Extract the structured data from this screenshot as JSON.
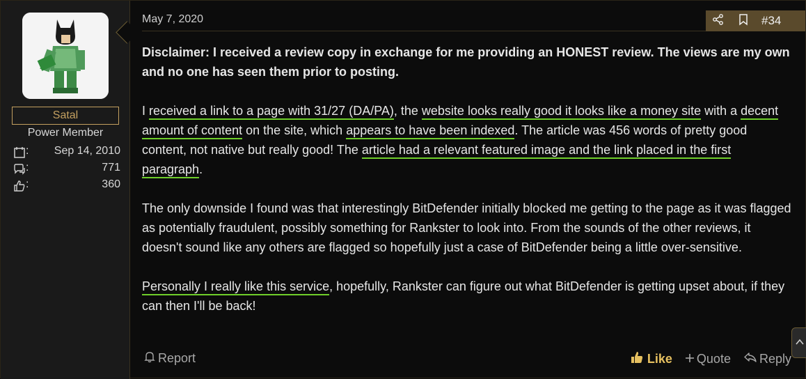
{
  "user": {
    "name": "Satal",
    "title": "Power Member",
    "stats": [
      {
        "icon": "calendar-icon",
        "value": "Sep 14, 2010"
      },
      {
        "icon": "messages-icon",
        "value": "771"
      },
      {
        "icon": "thumbs-up-icon",
        "value": "360"
      }
    ]
  },
  "post": {
    "date": "May 7, 2020",
    "number": "#34",
    "disclaimer": "Disclaimer: I received a review copy in exchange for me providing an HONEST review. The views are my own and no one has seen them prior to posting.",
    "p2": {
      "t1": "I ",
      "u1": "received a link to a page with 31/27 (DA/PA)",
      "t2": ", the ",
      "u2": "website looks really good it looks like a money site",
      "t3": " with a ",
      "u3": "decent amount of content",
      "t4": " on the site, which ",
      "u4": "appears to have been indexed",
      "t5": ". The article was 456 words of pretty good content, not native but really good! The ",
      "u5": "article had a relevant featured image and the link placed in the first paragraph",
      "t6": "."
    },
    "p3": "The only downside I found was that interestingly BitDefender initially blocked me getting to the page as it was flagged as potentially fraudulent, possibly something for Rankster to look into. From the sounds of the other reviews, it doesn't sound like any others are flagged so hopefully just a case of BitDefender being a little over-sensitive.",
    "p4": {
      "u1": "Personally I really like this service",
      "t1": ", hopefully, Rankster can figure out what BitDefender is getting upset about, if they can then I'll be back!"
    }
  },
  "footer": {
    "report": "Report",
    "like": "Like",
    "quote": "Quote",
    "reply": "Reply"
  },
  "colors": {
    "accent": "#c4a060",
    "underline": "#6fcf2a",
    "action_bar": "#5a4a2c"
  }
}
